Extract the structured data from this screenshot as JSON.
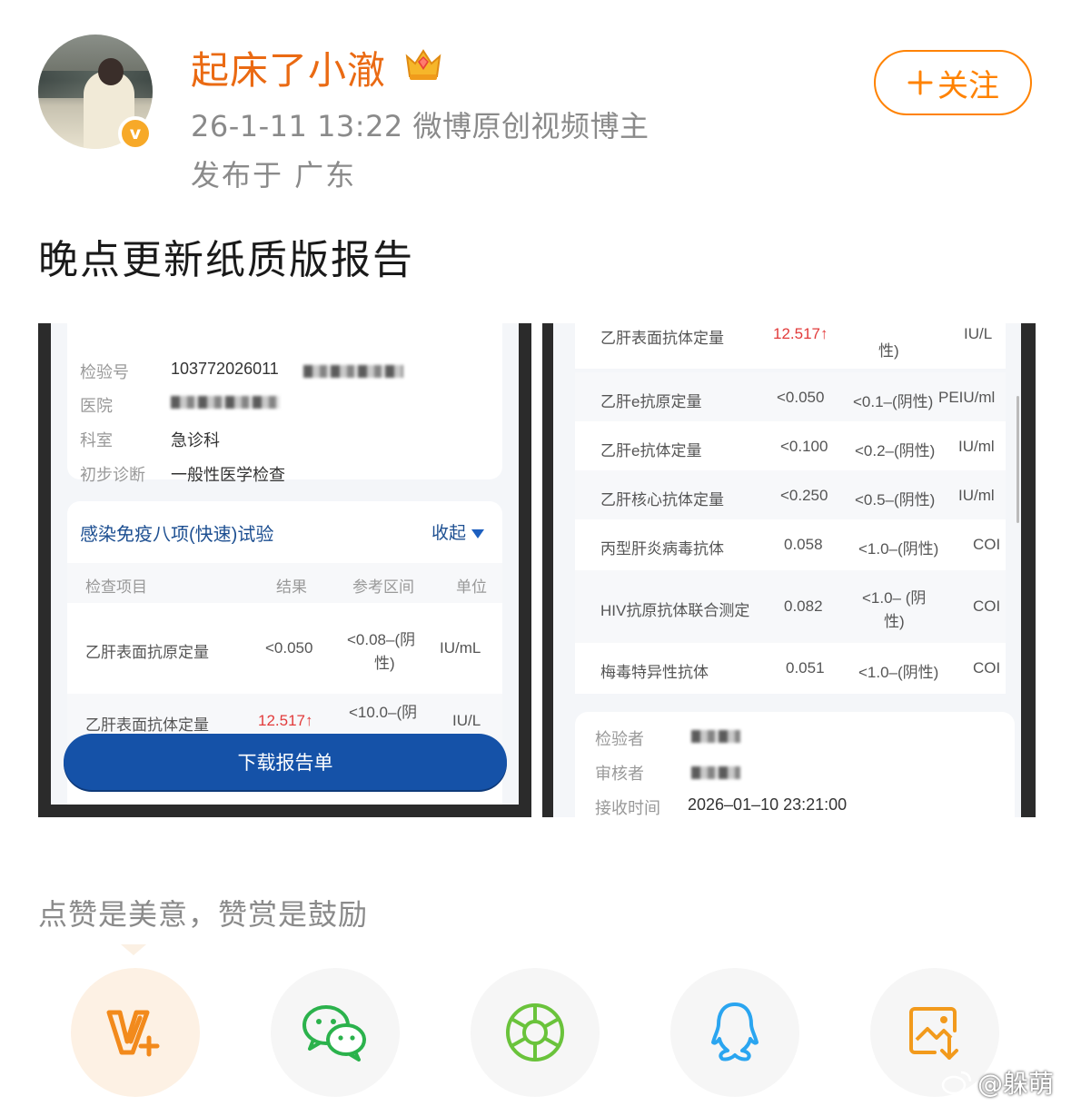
{
  "header": {
    "username": "起床了小澈",
    "meta": "26-1-11 13:22  微博原创视频博主",
    "location": "发布于 广东",
    "follow_label": "关注",
    "verified_badge": "v"
  },
  "post": {
    "text": "晚点更新纸质版报告"
  },
  "left_image": {
    "info": [
      {
        "label": "检验号",
        "value": "103772026011"
      },
      {
        "label": "医院",
        "value": ""
      },
      {
        "label": "科室",
        "value": "急诊科"
      },
      {
        "label": "初步诊断",
        "value": "一般性医学检查"
      }
    ],
    "test_title": "感染免疫八项(快速)试验",
    "collapse_label": "收起",
    "columns": [
      "检查项目",
      "结果",
      "参考区间",
      "单位"
    ],
    "rows": [
      {
        "item": "乙肝表面抗原定量",
        "result": "<0.050",
        "range_1": "<0.08–(阴",
        "range_2": "性)",
        "unit": "IU/mL"
      },
      {
        "item": "乙肝表面抗体定量",
        "result": "12.517↑",
        "range_1": "<10.0–(阴",
        "range_2": "",
        "unit": "IU/L"
      }
    ],
    "download_label": "下载报告单"
  },
  "right_image": {
    "rows": [
      {
        "item": "乙肝表面抗体定量",
        "result": "12.517↑",
        "range": "性)",
        "unit": "IU/L",
        "abnormal": true
      },
      {
        "item": "乙肝e抗原定量",
        "result": "<0.050",
        "range": "<0.1–(阴性)",
        "unit": "PEIU/ml"
      },
      {
        "item": "乙肝e抗体定量",
        "result": "<0.100",
        "range": "<0.2–(阴性)",
        "unit": "IU/ml"
      },
      {
        "item": "乙肝核心抗体定量",
        "result": "<0.250",
        "range": "<0.5–(阴性)",
        "unit": "IU/ml"
      },
      {
        "item": "丙型肝炎病毒抗体",
        "result": "0.058",
        "range": "<1.0–(阴性)",
        "unit": "COI"
      },
      {
        "item": "HIV抗原抗体联合测定",
        "result": "0.082",
        "range_1": "<1.0– (阴",
        "range_2": "性)",
        "unit": "COI"
      },
      {
        "item": "梅毒特异性抗体",
        "result": "0.051",
        "range": "<1.0–(阴性)",
        "unit": "COI"
      }
    ],
    "sign": [
      {
        "label": "检验者",
        "value": ""
      },
      {
        "label": "审核者",
        "value": ""
      },
      {
        "label": "接收时间",
        "value": "2026–01–10 23:21:00"
      }
    ]
  },
  "footer": {
    "slogan": "点赞是美意，赞赏是鼓励",
    "share_icons": [
      "vip-plus-icon",
      "wechat-icon",
      "moments-icon",
      "qq-icon",
      "save-image-icon"
    ],
    "watermark": "@躲萌"
  },
  "colors": {
    "username": "#ea6a13",
    "follow": "#ff8200",
    "report_blue": "#1552a8",
    "abnormal": "#e23b3b"
  }
}
